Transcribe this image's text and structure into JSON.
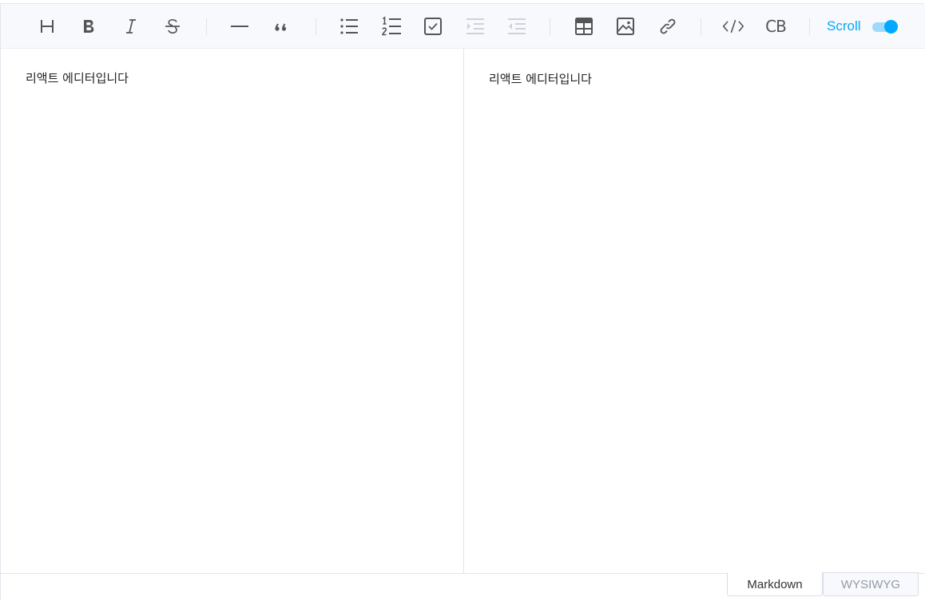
{
  "toolbar": {
    "scroll_label": "Scroll",
    "scroll_enabled": true,
    "code_block_label": "CB",
    "items": [
      {
        "name": "heading",
        "icon": "heading-icon"
      },
      {
        "name": "bold",
        "icon": "bold-icon"
      },
      {
        "name": "italic",
        "icon": "italic-icon"
      },
      {
        "name": "strike",
        "icon": "strike-icon"
      },
      {
        "name": "horizontal-rule",
        "icon": "hr-icon"
      },
      {
        "name": "quote",
        "icon": "quote-icon"
      },
      {
        "name": "bullet-list",
        "icon": "bullet-list-icon"
      },
      {
        "name": "ordered-list",
        "icon": "ordered-list-icon"
      },
      {
        "name": "task-list",
        "icon": "task-list-icon"
      },
      {
        "name": "indent",
        "icon": "indent-icon",
        "disabled": true
      },
      {
        "name": "outdent",
        "icon": "outdent-icon",
        "disabled": true
      },
      {
        "name": "table",
        "icon": "table-icon"
      },
      {
        "name": "image",
        "icon": "image-icon"
      },
      {
        "name": "link",
        "icon": "link-icon"
      },
      {
        "name": "code",
        "icon": "code-icon"
      },
      {
        "name": "code-block",
        "icon": "code-block-icon"
      }
    ],
    "accent_color": "#00a9ff"
  },
  "editor": {
    "markdown_content": "리액트 에디터입니다",
    "preview_content": "리액트 에디터입니다"
  },
  "mode_switch": {
    "markdown_label": "Markdown",
    "wysiwyg_label": "WYSIWYG",
    "active": "Markdown"
  }
}
